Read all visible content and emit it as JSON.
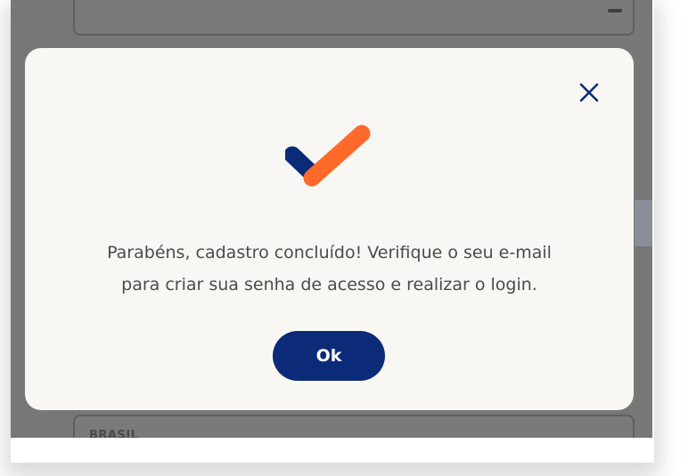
{
  "background": {
    "bottom_field_text": "BRASIL"
  },
  "dialog": {
    "message_line1": "Parabéns, cadastro concluído! Verifique o seu e-mail",
    "message_line2": "para criar sua senha de acesso e realizar o login.",
    "ok_label": "Ok",
    "close_icon": "close-icon",
    "success_icon": "checkmark-icon"
  },
  "colors": {
    "accent_blue": "#0b2a78",
    "accent_orange": "#ff6a2b",
    "overlay": "#777777",
    "dialog_bg": "#f8f7f3"
  }
}
